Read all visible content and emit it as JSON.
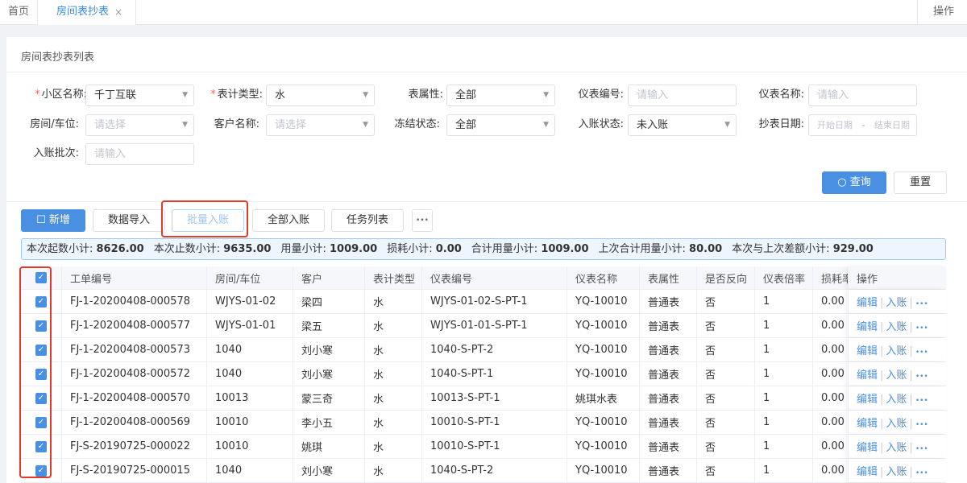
{
  "tabs": {
    "home": "首页",
    "active": "房间表抄表",
    "close": "×",
    "ops": "操作"
  },
  "panel": {
    "title": "房间表抄表列表"
  },
  "filters": {
    "community": {
      "label": "小区名称:",
      "value": "千丁互联"
    },
    "meter_type": {
      "label": "表计类型:",
      "value": "水"
    },
    "meter_attr": {
      "label": "表属性:",
      "value": "全部"
    },
    "meter_no": {
      "label": "仪表编号:",
      "placeholder": "请输入"
    },
    "meter_name": {
      "label": "仪表名称:",
      "placeholder": "请输入"
    },
    "room": {
      "label": "房间/车位:",
      "placeholder": "请选择"
    },
    "customer": {
      "label": "客户名称:",
      "placeholder": "请选择"
    },
    "freeze": {
      "label": "冻结状态:",
      "value": "全部"
    },
    "account_status": {
      "label": "入账状态:",
      "value": "未入账"
    },
    "read_date": {
      "label": "抄表日期:",
      "start_placeholder": "开始日期",
      "dash": "-",
      "end_placeholder": "结束日期"
    },
    "batch": {
      "label": "入账批次:",
      "placeholder": "请输入"
    }
  },
  "actions": {
    "query": "查询",
    "reset": "重置"
  },
  "toolbar": {
    "add": "新增",
    "import": "数据导入",
    "batch_account": "批量入账",
    "all_account": "全部入账",
    "tasks": "任务列表",
    "more": "•••"
  },
  "summary": [
    {
      "label": "本次起数小计:",
      "value": "8626.00"
    },
    {
      "label": "本次止数小计:",
      "value": "9635.00"
    },
    {
      "label": "用量小计:",
      "value": "1009.00"
    },
    {
      "label": "损耗小计:",
      "value": "0.00"
    },
    {
      "label": "合计用量小计:",
      "value": "1009.00"
    },
    {
      "label": "上次合计用量小计:",
      "value": "80.00"
    },
    {
      "label": "本次与上次差额小计:",
      "value": "929.00"
    }
  ],
  "table": {
    "columns": [
      "工单编号",
      "房间/车位",
      "客户",
      "表计类型",
      "仪表编号",
      "仪表名称",
      "表属性",
      "是否反向",
      "仪表倍率",
      "损耗率",
      "操作"
    ],
    "ops": {
      "edit": "编辑",
      "account": "入账",
      "more": "•••",
      "sep": "|"
    },
    "rows": [
      [
        "FJ-1-20200408-000578",
        "WJYS-01-02",
        "梁四",
        "水",
        "WJYS-01-02-S-PT-1",
        "YQ-10010",
        "普通表",
        "否",
        "1",
        "0.00"
      ],
      [
        "FJ-1-20200408-000577",
        "WJYS-01-01",
        "梁五",
        "水",
        "WJYS-01-01-S-PT-1",
        "YQ-10010",
        "普通表",
        "否",
        "1",
        "0.00"
      ],
      [
        "FJ-1-20200408-000573",
        "1040",
        "刘小寒",
        "水",
        "1040-S-PT-2",
        "YQ-10010",
        "普通表",
        "否",
        "1",
        "0.00"
      ],
      [
        "FJ-1-20200408-000572",
        "1040",
        "刘小寒",
        "水",
        "1040-S-PT-1",
        "YQ-10010",
        "普通表",
        "否",
        "1",
        "0.00"
      ],
      [
        "FJ-1-20200408-000570",
        "10013",
        "蒙三奇",
        "水",
        "10013-S-PT-1",
        "姚琪水表",
        "普通表",
        "否",
        "1",
        "0.00"
      ],
      [
        "FJ-1-20200408-000569",
        "10010",
        "李小五",
        "水",
        "10010-S-PT-1",
        "YQ-10010",
        "普通表",
        "否",
        "1",
        "0.00"
      ],
      [
        "FJ-S-20190725-000022",
        "10010",
        "姚琪",
        "水",
        "10010-S-PT-1",
        "YQ-10010",
        "普通表",
        "否",
        "1",
        "0.00"
      ],
      [
        "FJ-S-20190725-000015",
        "1040",
        "刘小寒",
        "水",
        "1040-S-PT-2",
        "YQ-10010",
        "普通表",
        "否",
        "1",
        "0.00"
      ]
    ]
  }
}
